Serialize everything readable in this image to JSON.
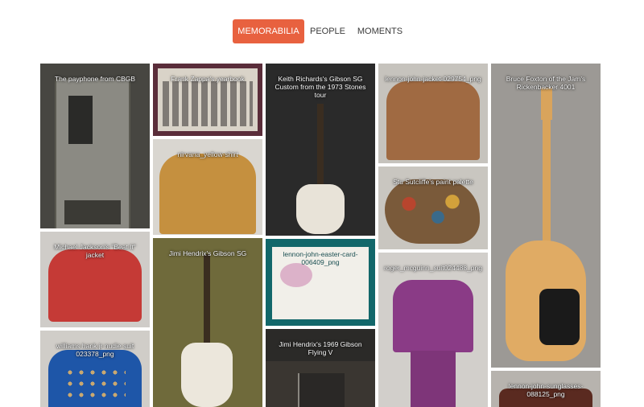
{
  "nav": {
    "tabs": [
      {
        "label": "MEMORABILIA",
        "active": true
      },
      {
        "label": "PEOPLE",
        "active": false
      },
      {
        "label": "MOMENTS",
        "active": false
      }
    ]
  },
  "tiles": [
    {
      "caption": "The payphone from CBGB",
      "bg": "#474641"
    },
    {
      "caption": "Frank Zappa's yearbook",
      "bg": "#5a2d3a"
    },
    {
      "caption": "nirvana_yellow-shirt",
      "bg": "#d9d6d0"
    },
    {
      "caption": "Michael Jackson's \"Beat It\" jacket",
      "bg": "#cfccc8"
    },
    {
      "caption": "williams hank jr nudie suit 023378_png",
      "bg": "#1e3d6b"
    },
    {
      "caption": "Jimi Hendrix's Gibson SG",
      "bg": "#6f6a3b"
    },
    {
      "caption": "Keith Richards's Gibson SG Custom from the 1973 Stones tour",
      "bg": "#2a2a2a"
    },
    {
      "caption": "lennon-john-easter-card-006409_png",
      "bg": "#12676a"
    },
    {
      "caption": "Jimi Hendrix's 1969 Gibson Flying V",
      "bg": "#2b2a28"
    },
    {
      "caption": "lennon-john-jacket-029754_png",
      "bg": "#c6c3bd"
    },
    {
      "caption": "Stu Sutcliffe's paint palette",
      "bg": "#c9c6c0"
    },
    {
      "caption": "roger_mcguinn_suit024488_png",
      "bg": "#d2cfcb"
    },
    {
      "caption": "Bruce Foxton of the Jam's Rickenbacker 4001",
      "bg": "#9c9995"
    },
    {
      "caption": "lennon-john-sunglasses-088125_png",
      "bg": "#b7b3ae"
    }
  ]
}
